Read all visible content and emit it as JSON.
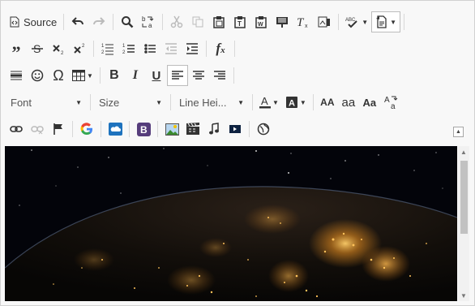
{
  "toolbar": {
    "source_label": "Source",
    "font_label": "Font",
    "size_label": "Size",
    "line_height_label": "Line Hei..."
  },
  "icons": {
    "source": "source-icon",
    "undo": "undo-icon",
    "redo": "redo-icon",
    "find": "find-icon",
    "replace": "replace-icon",
    "cut": "cut-icon",
    "copy": "copy-icon",
    "paste": "paste-icon",
    "paste_text": "paste-text-icon",
    "paste_word": "paste-word-icon",
    "format": "format-icon",
    "remove_format": "remove-format-icon",
    "image_edit": "image-edit-icon",
    "spellcheck": "spellcheck-icon",
    "templates": "templates-icon",
    "blockquote": "blockquote-icon",
    "strikethrough": "strikethrough-icon",
    "subscript": "subscript-icon",
    "superscript": "superscript-icon",
    "numbered_list": "numbered-list-icon",
    "ordered_list": "ordered-list-icon",
    "bulleted_list": "bulleted-list-icon",
    "outdent": "outdent-icon",
    "indent": "indent-icon",
    "formula": "formula-icon",
    "horizontal_line": "horizontal-line-icon",
    "emoji": "emoji-icon",
    "omega": "omega-icon",
    "table": "table-icon",
    "bold": "bold-icon",
    "italic": "italic-icon",
    "underline": "underline-icon",
    "align_left": "align-left-icon",
    "align_center": "align-center-icon",
    "align_right": "align-right-icon",
    "text_color": "text-color-icon",
    "bg_color": "background-color-icon",
    "uppercase": "uppercase-icon",
    "lowercase": "lowercase-icon",
    "capitalize": "capitalize-icon",
    "change_case": "change-case-icon",
    "link": "link-icon",
    "unlink": "unlink-icon",
    "anchor": "anchor-flag-icon",
    "google": "google-icon",
    "cloud": "onedrive-cloud-icon",
    "bootstrap": "bootstrap-icon",
    "image": "image-icon",
    "video": "video-icon",
    "audio": "audio-icon",
    "media": "media-player-icon",
    "globe": "globe-icon"
  },
  "colors": {
    "toolbar_bg": "#f8f8f8",
    "border": "#d1d1d1",
    "google_blue": "#4285F4",
    "bootstrap_purple": "#563d7c",
    "cloud_blue": "#1e73be"
  }
}
